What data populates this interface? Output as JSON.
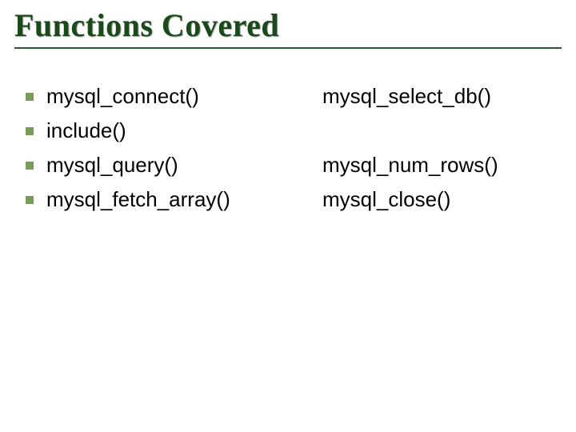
{
  "slide": {
    "title": "Functions Covered",
    "left_items": [
      "mysql_connect()",
      "include()",
      "mysql_query()",
      "mysql_fetch_array()"
    ],
    "right_items": [
      "mysql_select_db()",
      "",
      "mysql_num_rows()",
      "mysql_close()"
    ]
  }
}
